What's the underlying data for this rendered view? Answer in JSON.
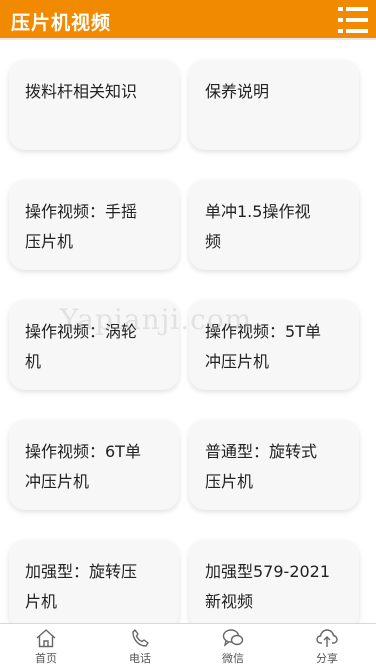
{
  "header": {
    "title": "压片机视频",
    "menu_icon": "menu-icon"
  },
  "cards": [
    {
      "line1": "拨料杆相关知识",
      "line2": ""
    },
    {
      "line1": "保养说明",
      "line2": ""
    },
    {
      "line1": "操作视频：手摇",
      "line2": "压片机"
    },
    {
      "line1": "单冲1.5操作视",
      "line2": "频"
    },
    {
      "line1": "操作视频：涡轮",
      "line2": "机"
    },
    {
      "line1": "操作视频：5T单",
      "line2": "冲压片机"
    },
    {
      "line1": "操作视频：6T单",
      "line2": "冲压片机"
    },
    {
      "line1": "普通型：旋转式",
      "line2": "压片机"
    },
    {
      "line1": "加强型：旋转压",
      "line2": "片机"
    },
    {
      "line1": "加强型579-2021",
      "line2": "新视频"
    }
  ],
  "watermark": "Yapianji.com",
  "footer": {
    "items": [
      {
        "label": "首页",
        "icon": "home-icon"
      },
      {
        "label": "电话",
        "icon": "phone-icon"
      },
      {
        "label": "微信",
        "icon": "chat-icon"
      },
      {
        "label": "分享",
        "icon": "share-icon"
      }
    ]
  },
  "colors": {
    "accent": "#f28a00",
    "card_bg": "#f7f7f7"
  }
}
